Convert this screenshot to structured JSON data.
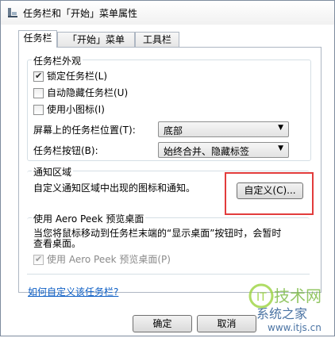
{
  "window": {
    "title": "任务栏和「开始」菜单属性"
  },
  "tabs": [
    {
      "label": "任务栏",
      "active": true
    },
    {
      "label": "「开始」菜单",
      "active": false
    },
    {
      "label": "工具栏",
      "active": false
    }
  ],
  "appearance": {
    "title": "任务栏外观",
    "lock": {
      "label": "锁定任务栏(L)",
      "checked": true
    },
    "autohide": {
      "label": "自动隐藏任务栏(U)",
      "checked": false
    },
    "small_icons": {
      "label": "使用小图标(I)",
      "checked": false
    },
    "location_label": "屏幕上的任务栏位置(T):",
    "location_value": "底部",
    "buttons_label": "任务栏按钮(B):",
    "buttons_value": "始终合并、隐藏标签"
  },
  "notification": {
    "title": "通知区域",
    "desc": "自定义通知区域中出现的图标和通知。",
    "customize_button": "自定义(C)..."
  },
  "peek": {
    "title": "使用 Aero Peek 预览桌面",
    "desc_line1": "当您将鼠标移动到任务栏末端的“显示桌面”按钮时，会暂时",
    "desc_line2": "查看桌面。",
    "checkbox_label": "使用 Aero Peek 预览桌面(P)",
    "checked": true,
    "disabled": true
  },
  "help_link": "如何自定义该任务栏?",
  "footer": {
    "ok_label": "确定",
    "cancel_label": "取消"
  },
  "watermark": {
    "line1": "技术网",
    "line2": "系统之家",
    "line3": "www.itjs.cn"
  },
  "colors": {
    "highlight": "#e23c3c",
    "link": "#0b5dc4"
  }
}
